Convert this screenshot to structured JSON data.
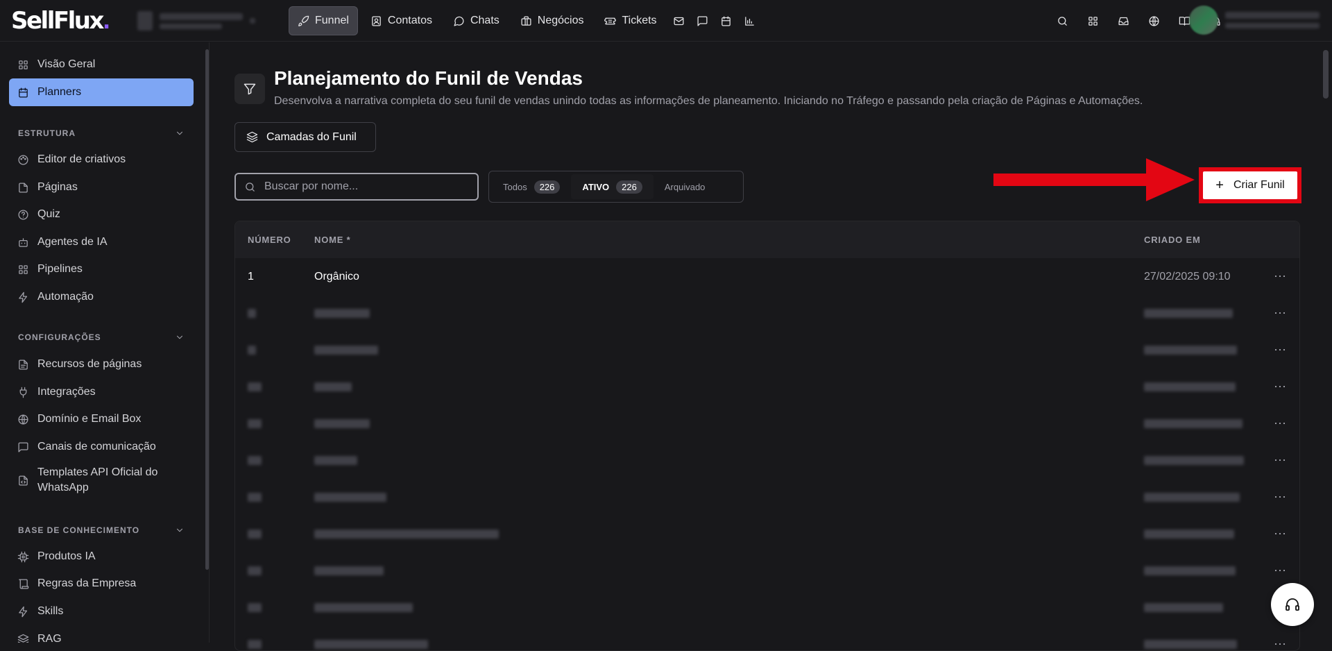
{
  "brand": {
    "name": "SellFlux"
  },
  "nav": {
    "items": [
      {
        "label": "Funnel",
        "icon": "rocket-icon",
        "active": true
      },
      {
        "label": "Contatos",
        "icon": "contact-card-icon"
      },
      {
        "label": "Chats",
        "icon": "chat-bubble-icon"
      },
      {
        "label": "Negócios",
        "icon": "briefcase-icon"
      },
      {
        "label": "Tickets",
        "icon": "ticket-icon"
      }
    ],
    "icon_only": [
      "mail-icon",
      "message-square-icon",
      "calendar-icon",
      "bar-chart-icon"
    ]
  },
  "topbar_right_icons": [
    "search-icon",
    "apps-grid-icon",
    "inbox-icon",
    "globe-icon",
    "book-icon",
    "headset-icon"
  ],
  "sidebar": {
    "top_items": [
      {
        "label": "Visão Geral",
        "icon": "dashboard-icon"
      },
      {
        "label": "Planners",
        "icon": "calendar-icon",
        "active": true
      }
    ],
    "sections": [
      {
        "title": "ESTRUTURA",
        "items": [
          {
            "label": "Editor de criativos",
            "icon": "palette-icon"
          },
          {
            "label": "Páginas",
            "icon": "file-icon"
          },
          {
            "label": "Quiz",
            "icon": "help-circle-icon"
          },
          {
            "label": "Agentes de IA",
            "icon": "bot-icon"
          },
          {
            "label": "Pipelines",
            "icon": "grid-icon"
          },
          {
            "label": "Automação",
            "icon": "zap-icon"
          }
        ]
      },
      {
        "title": "CONFIGURAÇÕES",
        "items": [
          {
            "label": "Recursos de páginas",
            "icon": "file-text-icon"
          },
          {
            "label": "Integrações",
            "icon": "plug-icon"
          },
          {
            "label": "Domínio e Email Box",
            "icon": "globe-icon"
          },
          {
            "label": "Canais de comunicação",
            "icon": "message-icon"
          },
          {
            "label": "Templates API Oficial do WhatsApp",
            "icon": "file-code-icon"
          }
        ]
      },
      {
        "title": "BASE DE CONHECIMENTO",
        "items": [
          {
            "label": "Produtos IA",
            "icon": "cpu-icon"
          },
          {
            "label": "Regras da Empresa",
            "icon": "scroll-icon"
          },
          {
            "label": "Skills",
            "icon": "zap-icon"
          },
          {
            "label": "RAG",
            "icon": "layers-icon"
          }
        ]
      }
    ]
  },
  "page": {
    "title": "Planejamento do Funil de Vendas",
    "subtitle": "Desenvolva a narrativa completa do seu funil de vendas unindo todas as informações de planeamento. Iniciando no Tráfego e passando pela criação de Páginas e Automações.",
    "layers_button": "Camadas do Funil",
    "search_placeholder": "Buscar por nome...",
    "filters": [
      {
        "label": "Todos",
        "count": "226"
      },
      {
        "label": "ATIVO",
        "count": "226",
        "active": true
      },
      {
        "label": "Arquivado",
        "count": ""
      }
    ],
    "create_button": "Criar Funil"
  },
  "table": {
    "headers": {
      "number": "NÚMERO",
      "name": "NOME *",
      "created": "CRIADO EM"
    },
    "rows": [
      {
        "number": "1",
        "name": "Orgânico",
        "created": "27/02/2025 09:10"
      }
    ],
    "blurred_rows": 10
  },
  "colors": {
    "accent": "#7ea6f4",
    "highlight": "#e30613",
    "brand_dot": "#8b5cf6"
  }
}
